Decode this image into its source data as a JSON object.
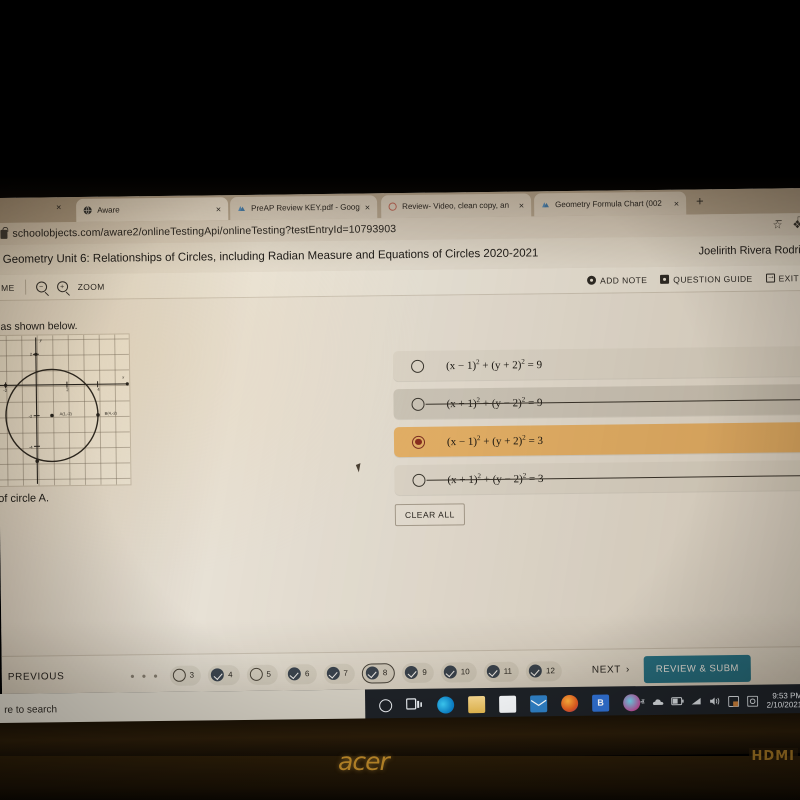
{
  "browser": {
    "tabs": [
      {
        "title": "Aware",
        "icon": "globe-icon",
        "active": true,
        "close_label": "×"
      },
      {
        "title": "PreAP Review KEY.pdf - Googl",
        "icon": "drive-icon",
        "active": false,
        "close_label": "×"
      },
      {
        "title": "Review- Video, clean copy, an",
        "icon": "circle-icon",
        "active": false,
        "close_label": "×"
      },
      {
        "title": "Geometry Formula Chart (002",
        "icon": "drive-icon",
        "active": false,
        "close_label": "×"
      }
    ],
    "leading_close_label": "×",
    "new_tab_label": "+",
    "url": "schoolobjects.com/aware2/onlineTestingApi/onlineTesting?testEntryId=10793903",
    "star_icon": "☆",
    "extension_icon": "❖",
    "minimize_label": "–",
    "maximize_label": "□"
  },
  "app": {
    "title": "Geometry Unit 6: Relationships of Circles, including Radian Measure and Equations of Circles 2020-2021",
    "user": "Joelirith Rivera Rodri",
    "toolbar": {
      "home_label": "ME",
      "zoom_label": "ZOOM",
      "zoom_out_icon": "magnifier-minus-icon",
      "zoom_in_icon": "magnifier-plus-icon",
      "add_note_label": "ADD NOTE",
      "question_guide_label": "QUESTION GUIDE",
      "exit_label": "EXIT"
    }
  },
  "question": {
    "stem_visible": "cated on circle A, as shown below.",
    "prompt_visible": "ne equation of circle A.",
    "graph": {
      "center_label": "A(1,-2)",
      "point_label": "B(4,-2)",
      "center": [
        1,
        -2
      ],
      "point_on_circle": [
        4,
        -2
      ],
      "radius": 3,
      "x_ticks": [
        "-4",
        "-2",
        "2",
        "4"
      ],
      "y_ticks": [
        "2",
        "-2",
        "-4"
      ],
      "x_axis_label": "x",
      "y_axis_label": "y"
    },
    "options": [
      {
        "id": "A",
        "text_pre": "(x − 1)",
        "sup1": "2",
        "text_mid": " + (y + 2)",
        "sup2": "2",
        "text_post": " = 9",
        "selected": false,
        "eliminated": false
      },
      {
        "id": "B",
        "text_pre": "(x + 1)",
        "sup1": "2",
        "text_mid": " + (y − 2)",
        "sup2": "2",
        "text_post": " = 9",
        "selected": false,
        "eliminated": true
      },
      {
        "id": "C",
        "text_pre": "(x − 1)",
        "sup1": "2",
        "text_mid": " + (y + 2)",
        "sup2": "2",
        "text_post": " = 3",
        "selected": true,
        "eliminated": false
      },
      {
        "id": "D",
        "text_pre": "(x + 1)",
        "sup1": "2",
        "text_mid": " + (y − 2)",
        "sup2": "2",
        "text_post": " = 3",
        "selected": false,
        "eliminated": true
      }
    ],
    "clear_all_label": "CLEAR ALL"
  },
  "navigation": {
    "previous_label": "PREVIOUS",
    "next_label": "NEXT",
    "next_chevron": "›",
    "ellipsis": "• • •",
    "review_label": "REVIEW & SUBM",
    "items": [
      {
        "num": "3",
        "answered": false,
        "current": false
      },
      {
        "num": "4",
        "answered": true,
        "current": false
      },
      {
        "num": "5",
        "answered": false,
        "current": false
      },
      {
        "num": "6",
        "answered": true,
        "current": false
      },
      {
        "num": "7",
        "answered": true,
        "current": false
      },
      {
        "num": "8",
        "answered": true,
        "current": true
      },
      {
        "num": "9",
        "answered": true,
        "current": false
      },
      {
        "num": "10",
        "answered": true,
        "current": false
      },
      {
        "num": "11",
        "answered": true,
        "current": false
      },
      {
        "num": "12",
        "answered": true,
        "current": false
      }
    ]
  },
  "taskbar": {
    "search_placeholder": "re to search",
    "icons": [
      "cortana-icon",
      "task-view-icon",
      "edge-icon",
      "file-explorer-icon",
      "microsoft-store-icon",
      "mail-icon",
      "firefox-icon",
      "b-app-icon",
      "music-app-icon"
    ],
    "b_app_letter": "B",
    "tray": {
      "chevron_up": "ⱏ",
      "onedrive_icon": "onedrive-icon",
      "battery_icon": "battery-icon",
      "wifi_icon": "wifi-icon",
      "volume_icon": "volume-icon",
      "action_center_icon": "action-center-icon",
      "misc_icon": "misc-tray-icon",
      "time": "9:53 PM",
      "date": "2/10/2021"
    }
  },
  "hardware": {
    "brand": "acer",
    "port_label": "HDMI"
  },
  "colors": {
    "selected_option": "#e8b469",
    "review_button": "#2b7b92",
    "taskbar": "#1d2126",
    "acer_logo": "#c08b2a"
  }
}
